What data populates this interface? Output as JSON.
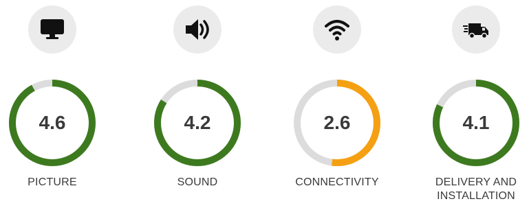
{
  "ratings": [
    {
      "label": "PICTURE",
      "score": "4.6",
      "value": 4.6,
      "max": 5,
      "color": "#3d7a1f",
      "icon": "monitor-icon"
    },
    {
      "label": "SOUND",
      "score": "4.2",
      "value": 4.2,
      "max": 5,
      "color": "#3d7a1f",
      "icon": "speaker-icon"
    },
    {
      "label": "CONNECTIVITY",
      "score": "2.6",
      "value": 2.6,
      "max": 5,
      "color": "#f5a012",
      "icon": "wifi-icon"
    },
    {
      "label": "DELIVERY AND INSTALLATION",
      "score": "4.1",
      "value": 4.1,
      "max": 5,
      "color": "#3d7a1f",
      "icon": "delivery-truck-icon"
    }
  ],
  "colors": {
    "track": "#dcdcdc",
    "icon_bg": "#ebebeb",
    "icon": "#111111",
    "text": "#3a3a3a"
  }
}
